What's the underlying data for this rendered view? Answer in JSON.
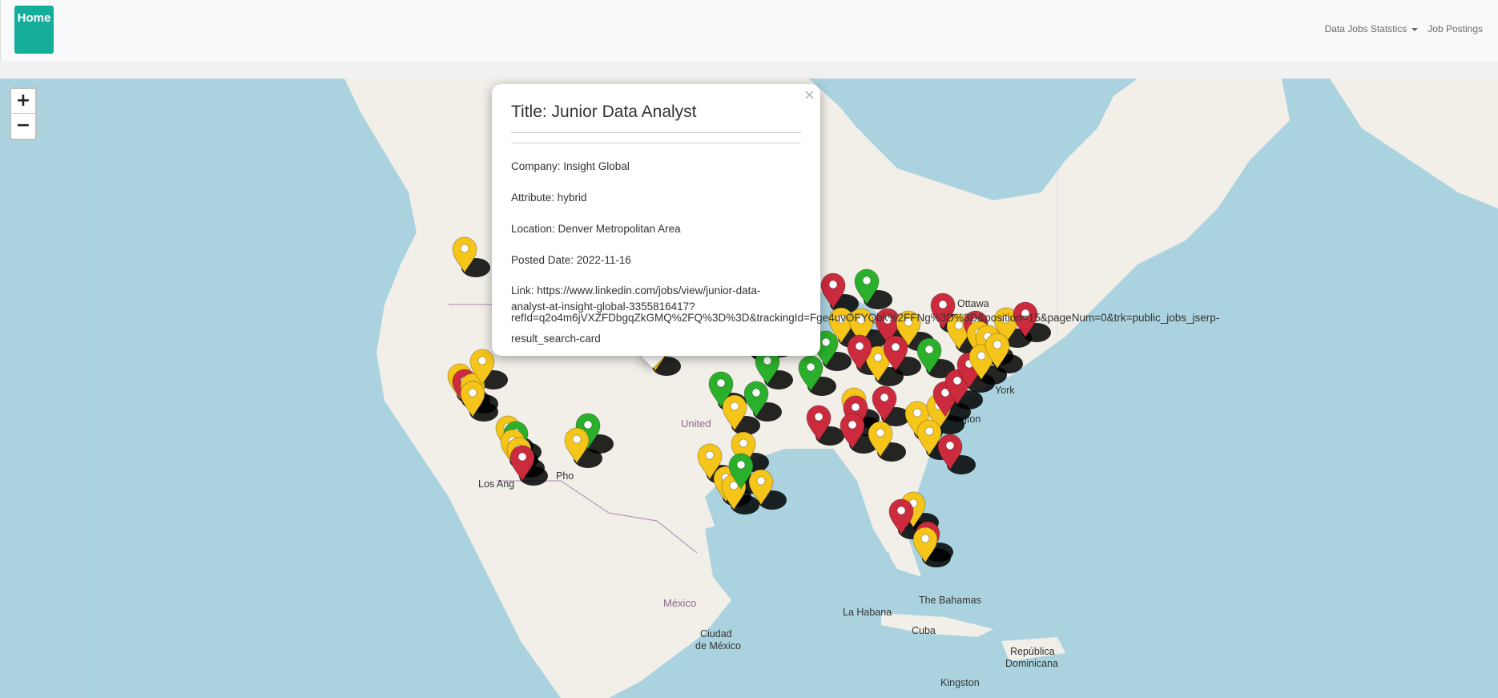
{
  "nav": {
    "home_label": "Home",
    "stats_label": "Data Jobs Statstics",
    "postings_label": "Job Postings"
  },
  "zoom": {
    "in_label": "+",
    "out_label": "−"
  },
  "popup": {
    "title": "Title: Junior Data Analyst",
    "company": "Company: Insight Global",
    "attribute": "Attribute: hybrid",
    "location": "Location: Denver Metropolitan Area",
    "posted": "Posted Date: 2022-11-16",
    "link_line1": "Link: https://www.linkedin.com/jobs/view/junior-data-",
    "link_line2": "analyst-at-insight-global-3355816417?",
    "link_line3": "refId=q2o4m6jVXZFDbgqZkGMQ%2FQ%3D%3D&trackingId=Fge4uvOFYQbk%2FFNg%3D%3D&position=15&pageNum=0&trk=public_jobs_jserp-",
    "link_line4": "result_search-card",
    "close_label": "×"
  },
  "map_labels": {
    "ottawa": "Ottawa",
    "york": "York",
    "ngton": "ngton",
    "united": "United",
    "phoenix": "Pho",
    "los_angeles": "Los Ang",
    "mexico": "México",
    "ciudad": "Ciudad",
    "de_mexico": "de México",
    "la_habana": "La Habana",
    "cuba": "Cuba",
    "bahamas": "The Bahamas",
    "republica": "República",
    "dominicana": "Dominicana",
    "kingston": "Kingston"
  },
  "colors": {
    "yellow_marker": "#f5c51a",
    "red_marker": "#cc2b3e",
    "green_marker": "#2bb02b",
    "water": "#aad3df",
    "land": "#f2efe9",
    "home_button": "#16ad9a"
  }
}
